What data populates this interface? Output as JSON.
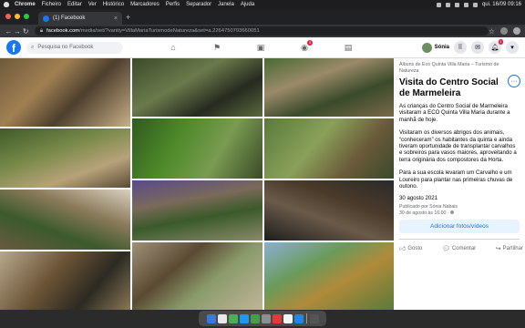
{
  "menubar": {
    "app": "Chrome",
    "items": [
      "Ficheiro",
      "Editar",
      "Ver",
      "Histórico",
      "Marcadores",
      "Perfis",
      "Separador",
      "Janela",
      "Ajuda"
    ],
    "clock": "qui. 16/09  09:16"
  },
  "tab": {
    "title": "(1) Facebook"
  },
  "address": {
    "host": "facebook.com",
    "path": "/media/set/?vanity=VillaMariaTurismodeNatureza&set=a.2264750703660051"
  },
  "facebook": {
    "logo": "f",
    "search_placeholder": "Pesquisa no Facebook",
    "nav_badge": "3",
    "user_name": "Sónia",
    "messenger_badge": "",
    "notif_badge": "1",
    "brand_color": "#1877f2"
  },
  "post": {
    "album": "Álbuns de Eco Quinta Villa Maria – Turismo de Natureza",
    "title": "Visita do Centro Social de Marmeleira",
    "paragraphs": [
      "As crianças do Centro Social de Marmeleira visitaram a ECO Quinta Villa Maria durante a manhã de hoje.",
      "Visitaram os diversos abrigos dos animais, “conheceram” os habitantes da quinta e ainda tiveram oportunidade de transplantar carvalhos e sobreiros para vasos maiores, aproveitando a terra originária dos compostores da Horta.",
      "Para a sua escola levaram um Carvalho e um Loureiro para plantar nas primeiras chuvas de outono."
    ],
    "date": "30 agosto 2021",
    "published_by": "Publicado por Sónia Nabais",
    "published_at": "30 de agosto às 16:00 ·",
    "add_button": "Adicionar fotos/vídeos",
    "like": "Gosto",
    "comment": "Comentar",
    "share": "Partilhar"
  }
}
